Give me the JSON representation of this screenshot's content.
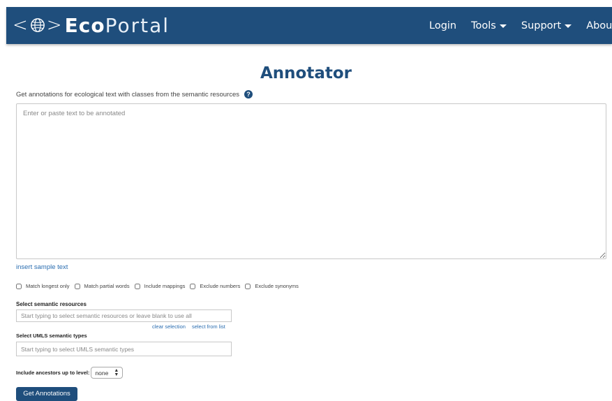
{
  "header": {
    "brand_left_chevron": "<",
    "brand_right_chevron": ">",
    "brand_eco": "Eco",
    "brand_portal": "Portal",
    "nav": [
      {
        "label": "Login"
      },
      {
        "label": "Tools",
        "dropdown": true
      },
      {
        "label": "Support",
        "dropdown": true
      },
      {
        "label": "About Us"
      }
    ],
    "colors": {
      "navbar_bg": "#1f4e7c",
      "text": "#ffffff"
    }
  },
  "main": {
    "title": "Annotator",
    "subtitle": "Get annotations for ecological text with classes from the semantic resources",
    "help_icon": "?",
    "text_input": {
      "placeholder": "Enter or paste text to be annotated",
      "value": ""
    },
    "insert_sample": "insert sample text",
    "options": [
      {
        "label": "Match longest only",
        "checked": false
      },
      {
        "label": "Match partial words",
        "checked": false
      },
      {
        "label": "Include mappings",
        "checked": false
      },
      {
        "label": "Exclude numbers",
        "checked": false
      },
      {
        "label": "Exclude synonyms",
        "checked": false
      }
    ],
    "semantic_resources": {
      "label": "Select semantic resources",
      "placeholder": "Start typing to select semantic resources or leave blank to use all",
      "clear_selection": "clear selection",
      "select_from_list": "select from list"
    },
    "umls": {
      "label": "Select UMLS semantic types",
      "placeholder": "Start typing to select UMLS semantic types"
    },
    "ancestors": {
      "label": "Include ancestors up to level:",
      "selected": "none",
      "arrow_up": "▲",
      "arrow_down": "▼"
    },
    "submit_label": "Get Annotations",
    "accent_color": "#1f4e7c",
    "link_color": "#2a6db0"
  }
}
